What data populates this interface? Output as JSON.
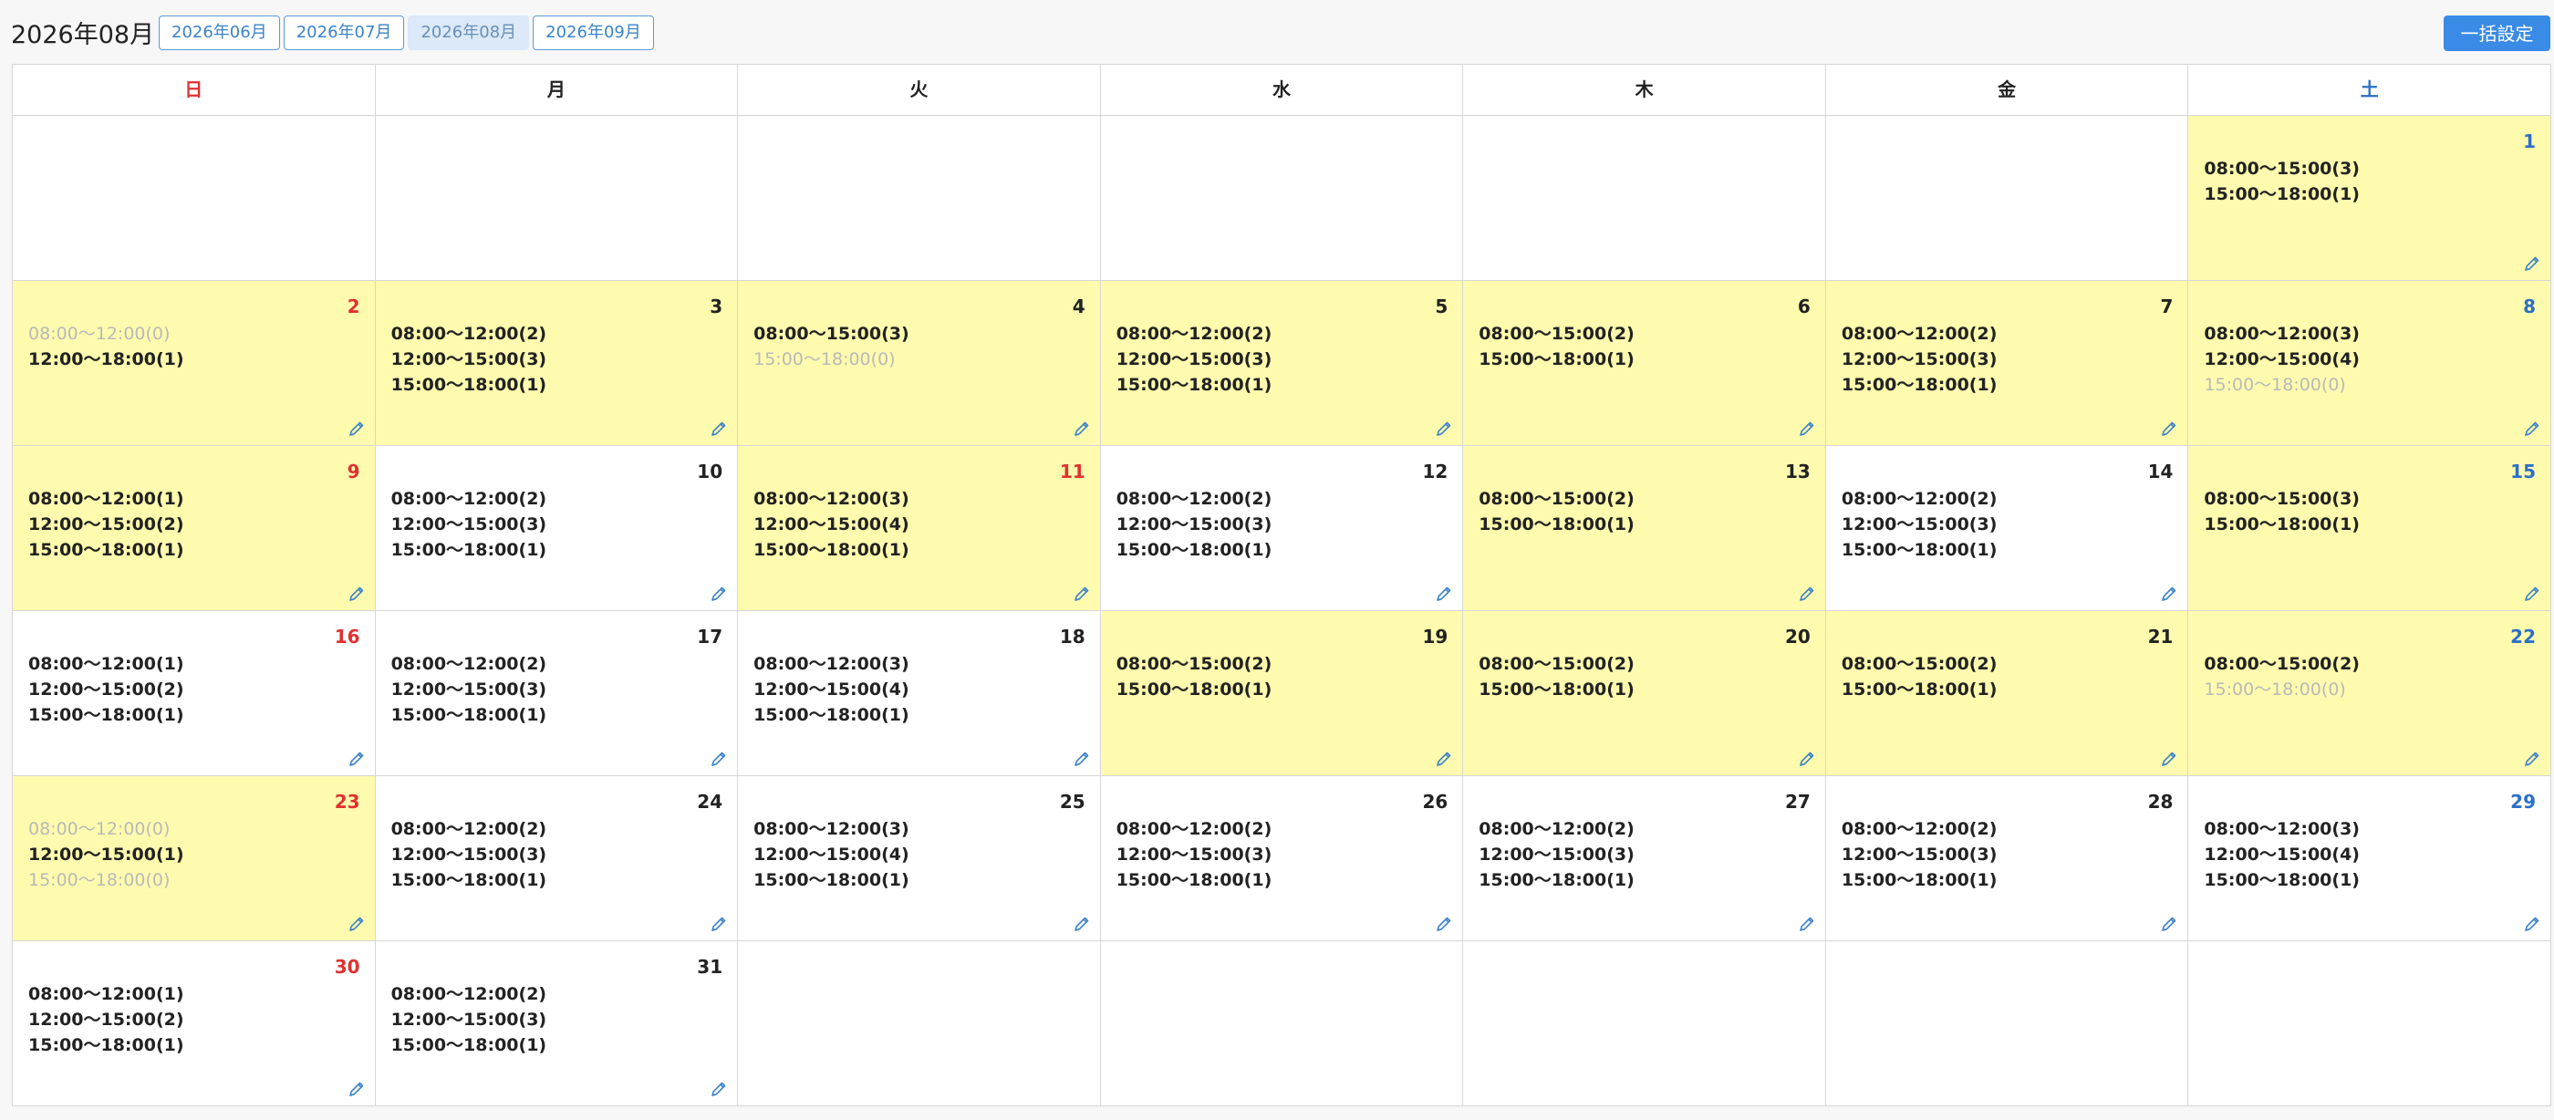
{
  "header": {
    "title": "2026年08月",
    "month_tabs": [
      {
        "label": "2026年06月",
        "active": false
      },
      {
        "label": "2026年07月",
        "active": false
      },
      {
        "label": "2026年08月",
        "active": true
      },
      {
        "label": "2026年09月",
        "active": false
      }
    ],
    "bulk_button_label": "一括設定"
  },
  "colors": {
    "highlight": "#fffbae",
    "sunday": "#e03131",
    "saturday": "#2c6fc7",
    "accent": "#3a8be6",
    "zero_slot": "#b9b9b9"
  },
  "weekdays": [
    "日",
    "月",
    "火",
    "水",
    "木",
    "金",
    "土"
  ],
  "weeks": [
    [
      null,
      null,
      null,
      null,
      null,
      null,
      {
        "day": "1",
        "highlight": true,
        "slots": [
          {
            "text": "08:00〜15:00(3)",
            "zero": false
          },
          {
            "text": "15:00〜18:00(1)",
            "zero": false
          }
        ]
      }
    ],
    [
      {
        "day": "2",
        "highlight": true,
        "slots": [
          {
            "text": "08:00〜12:00(0)",
            "zero": true
          },
          {
            "text": "12:00〜18:00(1)",
            "zero": false
          }
        ]
      },
      {
        "day": "3",
        "highlight": true,
        "slots": [
          {
            "text": "08:00〜12:00(2)",
            "zero": false
          },
          {
            "text": "12:00〜15:00(3)",
            "zero": false
          },
          {
            "text": "15:00〜18:00(1)",
            "zero": false
          }
        ]
      },
      {
        "day": "4",
        "highlight": true,
        "slots": [
          {
            "text": "08:00〜15:00(3)",
            "zero": false
          },
          {
            "text": "15:00〜18:00(0)",
            "zero": true
          }
        ]
      },
      {
        "day": "5",
        "highlight": true,
        "slots": [
          {
            "text": "08:00〜12:00(2)",
            "zero": false
          },
          {
            "text": "12:00〜15:00(3)",
            "zero": false
          },
          {
            "text": "15:00〜18:00(1)",
            "zero": false
          }
        ]
      },
      {
        "day": "6",
        "highlight": true,
        "slots": [
          {
            "text": "08:00〜15:00(2)",
            "zero": false
          },
          {
            "text": "15:00〜18:00(1)",
            "zero": false
          }
        ]
      },
      {
        "day": "7",
        "highlight": true,
        "slots": [
          {
            "text": "08:00〜12:00(2)",
            "zero": false
          },
          {
            "text": "12:00〜15:00(3)",
            "zero": false
          },
          {
            "text": "15:00〜18:00(1)",
            "zero": false
          }
        ]
      },
      {
        "day": "8",
        "highlight": true,
        "slots": [
          {
            "text": "08:00〜12:00(3)",
            "zero": false
          },
          {
            "text": "12:00〜15:00(4)",
            "zero": false
          },
          {
            "text": "15:00〜18:00(0)",
            "zero": true
          }
        ]
      }
    ],
    [
      {
        "day": "9",
        "highlight": true,
        "slots": [
          {
            "text": "08:00〜12:00(1)",
            "zero": false
          },
          {
            "text": "12:00〜15:00(2)",
            "zero": false
          },
          {
            "text": "15:00〜18:00(1)",
            "zero": false
          }
        ]
      },
      {
        "day": "10",
        "highlight": false,
        "slots": [
          {
            "text": "08:00〜12:00(2)",
            "zero": false
          },
          {
            "text": "12:00〜15:00(3)",
            "zero": false
          },
          {
            "text": "15:00〜18:00(1)",
            "zero": false
          }
        ]
      },
      {
        "day": "11",
        "highlight": true,
        "holiday": true,
        "slots": [
          {
            "text": "08:00〜12:00(3)",
            "zero": false
          },
          {
            "text": "12:00〜15:00(4)",
            "zero": false
          },
          {
            "text": "15:00〜18:00(1)",
            "zero": false
          }
        ]
      },
      {
        "day": "12",
        "highlight": false,
        "slots": [
          {
            "text": "08:00〜12:00(2)",
            "zero": false
          },
          {
            "text": "12:00〜15:00(3)",
            "zero": false
          },
          {
            "text": "15:00〜18:00(1)",
            "zero": false
          }
        ]
      },
      {
        "day": "13",
        "highlight": true,
        "slots": [
          {
            "text": "08:00〜15:00(2)",
            "zero": false
          },
          {
            "text": "15:00〜18:00(1)",
            "zero": false
          }
        ]
      },
      {
        "day": "14",
        "highlight": false,
        "slots": [
          {
            "text": "08:00〜12:00(2)",
            "zero": false
          },
          {
            "text": "12:00〜15:00(3)",
            "zero": false
          },
          {
            "text": "15:00〜18:00(1)",
            "zero": false
          }
        ]
      },
      {
        "day": "15",
        "highlight": true,
        "slots": [
          {
            "text": "08:00〜15:00(3)",
            "zero": false
          },
          {
            "text": "15:00〜18:00(1)",
            "zero": false
          }
        ]
      }
    ],
    [
      {
        "day": "16",
        "highlight": false,
        "slots": [
          {
            "text": "08:00〜12:00(1)",
            "zero": false
          },
          {
            "text": "12:00〜15:00(2)",
            "zero": false
          },
          {
            "text": "15:00〜18:00(1)",
            "zero": false
          }
        ]
      },
      {
        "day": "17",
        "highlight": false,
        "slots": [
          {
            "text": "08:00〜12:00(2)",
            "zero": false
          },
          {
            "text": "12:00〜15:00(3)",
            "zero": false
          },
          {
            "text": "15:00〜18:00(1)",
            "zero": false
          }
        ]
      },
      {
        "day": "18",
        "highlight": false,
        "slots": [
          {
            "text": "08:00〜12:00(3)",
            "zero": false
          },
          {
            "text": "12:00〜15:00(4)",
            "zero": false
          },
          {
            "text": "15:00〜18:00(1)",
            "zero": false
          }
        ]
      },
      {
        "day": "19",
        "highlight": true,
        "slots": [
          {
            "text": "08:00〜15:00(2)",
            "zero": false
          },
          {
            "text": "15:00〜18:00(1)",
            "zero": false
          }
        ]
      },
      {
        "day": "20",
        "highlight": true,
        "slots": [
          {
            "text": "08:00〜15:00(2)",
            "zero": false
          },
          {
            "text": "15:00〜18:00(1)",
            "zero": false
          }
        ]
      },
      {
        "day": "21",
        "highlight": true,
        "slots": [
          {
            "text": "08:00〜15:00(2)",
            "zero": false
          },
          {
            "text": "15:00〜18:00(1)",
            "zero": false
          }
        ]
      },
      {
        "day": "22",
        "highlight": true,
        "slots": [
          {
            "text": "08:00〜15:00(2)",
            "zero": false
          },
          {
            "text": "15:00〜18:00(0)",
            "zero": true
          }
        ]
      }
    ],
    [
      {
        "day": "23",
        "highlight": true,
        "slots": [
          {
            "text": "08:00〜12:00(0)",
            "zero": true
          },
          {
            "text": "12:00〜15:00(1)",
            "zero": false
          },
          {
            "text": "15:00〜18:00(0)",
            "zero": true
          }
        ]
      },
      {
        "day": "24",
        "highlight": false,
        "slots": [
          {
            "text": "08:00〜12:00(2)",
            "zero": false
          },
          {
            "text": "12:00〜15:00(3)",
            "zero": false
          },
          {
            "text": "15:00〜18:00(1)",
            "zero": false
          }
        ]
      },
      {
        "day": "25",
        "highlight": false,
        "slots": [
          {
            "text": "08:00〜12:00(3)",
            "zero": false
          },
          {
            "text": "12:00〜15:00(4)",
            "zero": false
          },
          {
            "text": "15:00〜18:00(1)",
            "zero": false
          }
        ]
      },
      {
        "day": "26",
        "highlight": false,
        "slots": [
          {
            "text": "08:00〜12:00(2)",
            "zero": false
          },
          {
            "text": "12:00〜15:00(3)",
            "zero": false
          },
          {
            "text": "15:00〜18:00(1)",
            "zero": false
          }
        ]
      },
      {
        "day": "27",
        "highlight": false,
        "slots": [
          {
            "text": "08:00〜12:00(2)",
            "zero": false
          },
          {
            "text": "12:00〜15:00(3)",
            "zero": false
          },
          {
            "text": "15:00〜18:00(1)",
            "zero": false
          }
        ]
      },
      {
        "day": "28",
        "highlight": false,
        "slots": [
          {
            "text": "08:00〜12:00(2)",
            "zero": false
          },
          {
            "text": "12:00〜15:00(3)",
            "zero": false
          },
          {
            "text": "15:00〜18:00(1)",
            "zero": false
          }
        ]
      },
      {
        "day": "29",
        "highlight": false,
        "slots": [
          {
            "text": "08:00〜12:00(3)",
            "zero": false
          },
          {
            "text": "12:00〜15:00(4)",
            "zero": false
          },
          {
            "text": "15:00〜18:00(1)",
            "zero": false
          }
        ]
      }
    ],
    [
      {
        "day": "30",
        "highlight": false,
        "slots": [
          {
            "text": "08:00〜12:00(1)",
            "zero": false
          },
          {
            "text": "12:00〜15:00(2)",
            "zero": false
          },
          {
            "text": "15:00〜18:00(1)",
            "zero": false
          }
        ]
      },
      {
        "day": "31",
        "highlight": false,
        "slots": [
          {
            "text": "08:00〜12:00(2)",
            "zero": false
          },
          {
            "text": "12:00〜15:00(3)",
            "zero": false
          },
          {
            "text": "15:00〜18:00(1)",
            "zero": false
          }
        ]
      },
      null,
      null,
      null,
      null,
      null
    ]
  ]
}
